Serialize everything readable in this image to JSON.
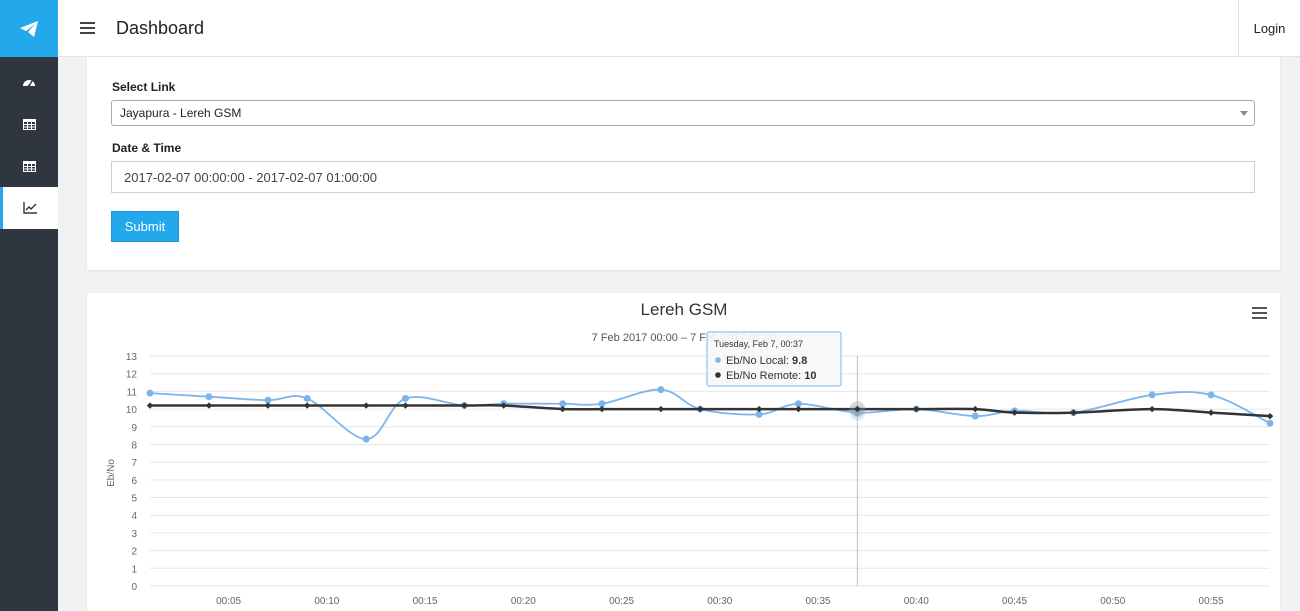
{
  "header": {
    "title": "Dashboard",
    "login_label": "Login"
  },
  "sidebar": {
    "items": [
      {
        "icon": "dashboard-icon"
      },
      {
        "icon": "table-icon"
      },
      {
        "icon": "table-icon"
      },
      {
        "icon": "line-chart-icon",
        "active": true
      }
    ]
  },
  "form": {
    "link_label": "Select Link",
    "link_value": "Jayapura - Lereh GSM",
    "datetime_label": "Date & Time",
    "datetime_value": "2017-02-07 00:00:00 - 2017-02-07 01:00:00",
    "submit_label": "Submit"
  },
  "colors": {
    "accent": "#23a8ec",
    "sidebar_bg": "#2f3640",
    "series_local": "#7cb5ec",
    "series_remote": "#333333"
  },
  "chart_data": {
    "type": "line",
    "title": "Lereh GSM",
    "subtitle": "7 Feb 2017 00:00 – 7 Feb 2017 01:00",
    "ylabel": "Eb/No",
    "ylim": [
      0,
      13
    ],
    "yticks": [
      0,
      1,
      2,
      3,
      4,
      5,
      6,
      7,
      8,
      9,
      10,
      11,
      12,
      13
    ],
    "xlim": [
      "00:01",
      "00:58"
    ],
    "xticks": [
      "00:05",
      "00:10",
      "00:15",
      "00:20",
      "00:25",
      "00:30",
      "00:35",
      "00:40",
      "00:45",
      "00:50",
      "00:55"
    ],
    "grid": true,
    "series": [
      {
        "name": "Eb/No Local",
        "x": [
          "00:01",
          "00:04",
          "00:07",
          "00:09",
          "00:12",
          "00:14",
          "00:17",
          "00:19",
          "00:22",
          "00:24",
          "00:27",
          "00:29",
          "00:32",
          "00:34",
          "00:37",
          "00:40",
          "00:43",
          "00:45",
          "00:48",
          "00:52",
          "00:55",
          "00:58"
        ],
        "values": [
          10.9,
          10.7,
          10.5,
          10.6,
          8.3,
          10.6,
          10.2,
          10.3,
          10.3,
          10.3,
          11.1,
          10.0,
          9.7,
          10.3,
          9.8,
          10.0,
          9.6,
          9.9,
          9.8,
          10.8,
          10.8,
          9.2
        ]
      },
      {
        "name": "Eb/No Remote",
        "x": [
          "00:01",
          "00:04",
          "00:07",
          "00:09",
          "00:12",
          "00:14",
          "00:17",
          "00:19",
          "00:22",
          "00:24",
          "00:27",
          "00:29",
          "00:32",
          "00:34",
          "00:37",
          "00:40",
          "00:43",
          "00:45",
          "00:48",
          "00:52",
          "00:55",
          "00:58"
        ],
        "values": [
          10.2,
          10.2,
          10.2,
          10.2,
          10.2,
          10.2,
          10.2,
          10.2,
          10.0,
          10.0,
          10.0,
          10.0,
          10.0,
          10.0,
          10.0,
          10.0,
          10.0,
          9.8,
          9.8,
          10.0,
          9.8,
          9.6
        ]
      }
    ],
    "tooltip": {
      "header": "Tuesday, Feb 7, 00:37",
      "local_label": "Eb/No Local:",
      "local_value": "9.8",
      "remote_label": "Eb/No Remote:",
      "remote_value": "10"
    }
  }
}
